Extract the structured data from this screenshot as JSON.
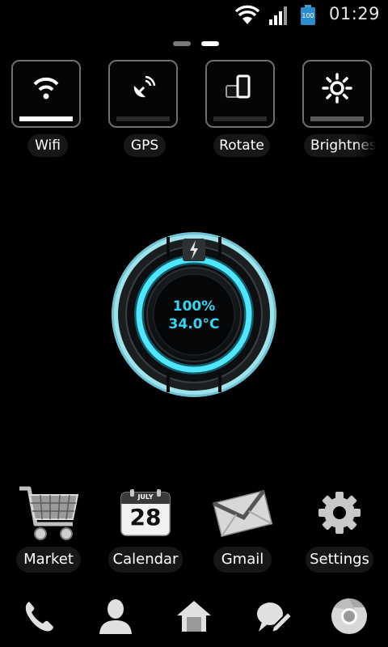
{
  "status_bar": {
    "icons": [
      "wifi-icon",
      "signal-icon",
      "battery-icon"
    ],
    "battery_level": "100",
    "time": "01:29"
  },
  "page_indicator": {
    "pages": 2,
    "current": 2
  },
  "toggles": [
    {
      "label": "Wifi",
      "icon": "wifi-icon",
      "state": "on"
    },
    {
      "label": "GPS",
      "icon": "gps-icon",
      "state": "off"
    },
    {
      "label": "Rotate",
      "icon": "rotate-icon",
      "state": "off"
    },
    {
      "label": "Brightness",
      "icon": "brightness-icon",
      "state": "partial"
    }
  ],
  "battery_widget": {
    "percent": "100%",
    "temperature": "34.0°C",
    "level": 1.0,
    "accent": "#36d6f0"
  },
  "apps": [
    {
      "label": "Market",
      "icon": "cart-icon"
    },
    {
      "label": "Calendar",
      "icon": "calendar-icon",
      "month": "JULY",
      "day": "28"
    },
    {
      "label": "Gmail",
      "icon": "gmail-icon"
    },
    {
      "label": "Settings",
      "icon": "gear-icon"
    }
  ],
  "dock": [
    "phone-icon",
    "contacts-icon",
    "home-icon",
    "messaging-icon",
    "browser-icon"
  ]
}
